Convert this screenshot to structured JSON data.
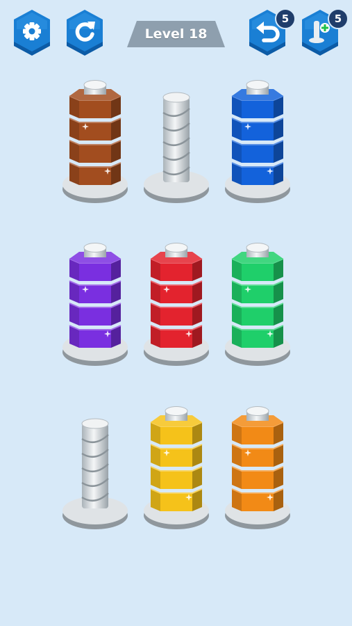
{
  "hud": {
    "settings": {
      "icon": "gear-icon"
    },
    "restart": {
      "icon": "restart-icon"
    },
    "level_label": "Level 18",
    "undo": {
      "icon": "undo-icon",
      "count": "5"
    },
    "add_bolt": {
      "icon": "add-bolt-icon",
      "count": "5"
    }
  },
  "colors": {
    "button_fill": "#1a7fd4",
    "button_dark": "#0c5ba6",
    "banner": "#8e9fae",
    "badge": "#1f3d6b",
    "brown": "#a24d1f",
    "blue": "#1362db",
    "purple": "#7a2fe0",
    "red": "#e3232e",
    "green": "#1fcf6a",
    "yellow": "#f5c21a",
    "orange": "#f28a16"
  },
  "board": {
    "rows": [
      [
        {
          "nut_color": "brown",
          "nuts": 4
        },
        {
          "nut_color": "empty",
          "nuts": 0
        },
        {
          "nut_color": "blue",
          "nuts": 4
        }
      ],
      [
        {
          "nut_color": "purple",
          "nuts": 4
        },
        {
          "nut_color": "red",
          "nuts": 4
        },
        {
          "nut_color": "green",
          "nuts": 4
        }
      ],
      [
        {
          "nut_color": "empty",
          "nuts": 0
        },
        {
          "nut_color": "yellow",
          "nuts": 4
        },
        {
          "nut_color": "orange",
          "nuts": 4
        }
      ]
    ]
  }
}
